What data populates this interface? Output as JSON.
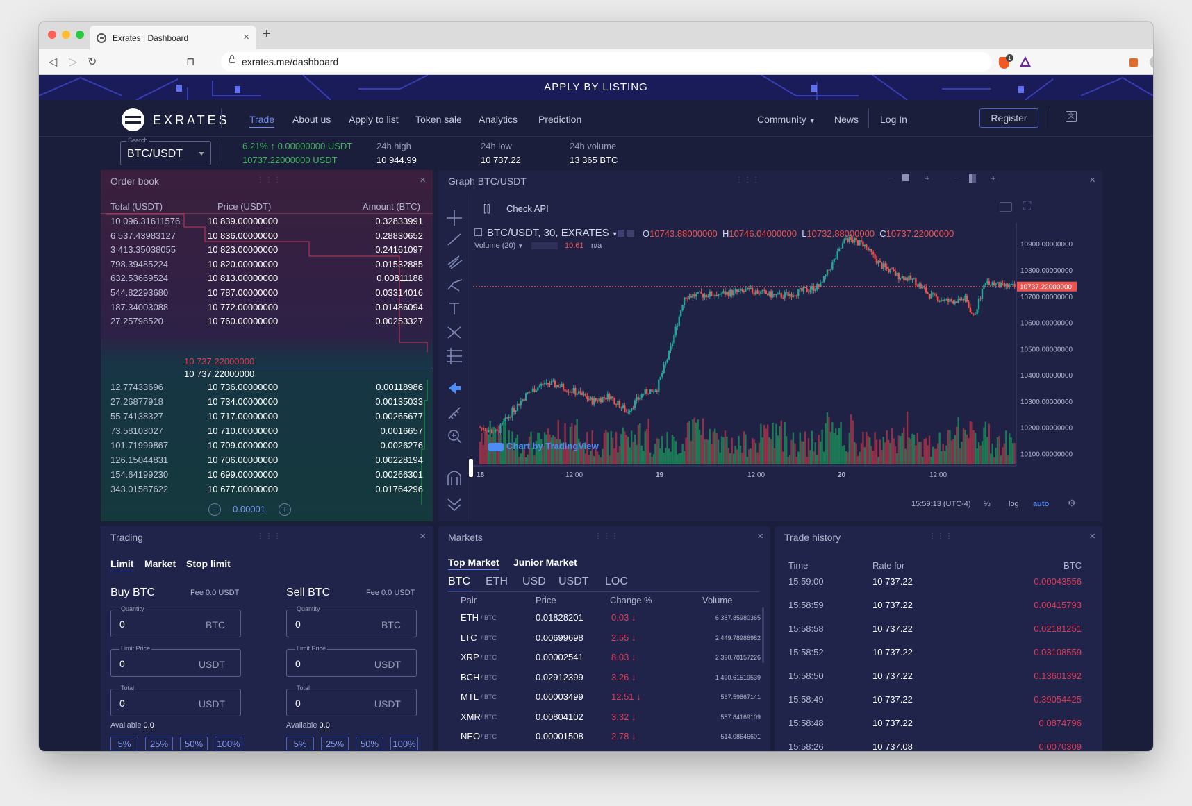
{
  "browser": {
    "tab_title": "Exrates | Dashboard",
    "url": "exrates.me/dashboard"
  },
  "site": {
    "banner": "APPLY BY LISTING",
    "logo": "EXRATES",
    "nav": [
      "Trade",
      "About us",
      "Apply to list",
      "Token sale",
      "Analytics",
      "Prediction"
    ],
    "community": "Community",
    "news": "News",
    "login": "Log In",
    "register": "Register"
  },
  "ticker": {
    "search_label": "Search",
    "pair": "BTC/USDT",
    "change": "6.21% ↑ 0.00000000 USDT",
    "last": "10737.22000000 USDT",
    "high_label": "24h high",
    "high": "10 944.99",
    "low_label": "24h low",
    "low": "10 737.22",
    "vol_label": "24h volume",
    "vol": "13 365 BTC"
  },
  "orderbook": {
    "title": "Order book",
    "headers": [
      "Total (USDT)",
      "Price (USDT)",
      "Amount (BTC)"
    ],
    "asks": [
      [
        "10 096.31611576",
        "10 839.00000000",
        "0.32833991"
      ],
      [
        "6 537.43983127",
        "10 836.00000000",
        "0.28830652"
      ],
      [
        "3 413.35038055",
        "10 823.00000000",
        "0.24161097"
      ],
      [
        "798.39485224",
        "10 820.00000000",
        "0.01532885"
      ],
      [
        "632.53669524",
        "10 813.00000000",
        "0.00811188"
      ],
      [
        "544.82293680",
        "10 787.00000000",
        "0.03314016"
      ],
      [
        "187.34003088",
        "10 772.00000000",
        "0.01486094"
      ],
      [
        "27.25798520",
        "10 760.00000000",
        "0.00253327"
      ]
    ],
    "last_price_red": "10 737.22000000",
    "last_price": "10 737.22000000",
    "bids": [
      [
        "12.77433696",
        "10 736.00000000",
        "0.00118986"
      ],
      [
        "27.26877918",
        "10 734.00000000",
        "0.00135033"
      ],
      [
        "55.74138327",
        "10 717.00000000",
        "0.00265677"
      ],
      [
        "73.58103027",
        "10 710.00000000",
        "0.0016657"
      ],
      [
        "101.71999867",
        "10 709.00000000",
        "0.0026276"
      ],
      [
        "126.15044831",
        "10 706.00000000",
        "0.00228194"
      ],
      [
        "154.64199230",
        "10 699.00000000",
        "0.00266301"
      ],
      [
        "343.01587622",
        "10 677.00000000",
        "0.01764296"
      ]
    ],
    "step": "0.00001"
  },
  "graph": {
    "title": "Graph BTC/USDT",
    "check_api": "Check API",
    "symbol": "BTC/USDT, 30, EXRATES",
    "o_label": "O",
    "o": "10743.88000000",
    "h_label": "H",
    "h": "10746.04000000",
    "l_label": "L",
    "l": "10732.88000000",
    "c_label": "C",
    "c": "10737.22000000",
    "volume_label": "Volume (20)",
    "volume_val": "10.61",
    "volume_na": "n/a",
    "watermark": "Chart by TradingView",
    "time": "15:59:13 (UTC-4)",
    "pct": "%",
    "log": "log",
    "auto": "auto",
    "price_tag": "10737.22000000",
    "colors": {
      "up": "#26a69a",
      "down": "#ef5350",
      "vol_up": "#1d8a5a",
      "vol_down": "#a8324a"
    }
  },
  "chart_data": {
    "type": "candlestick",
    "x_ticks": [
      "18",
      "12:00",
      "19",
      "12:00",
      "20",
      "12:00"
    ],
    "y_ticks": [
      "10900.00000000",
      "10800.00000000",
      "10700.00000000",
      "10600.00000000",
      "10500.00000000",
      "10400.00000000",
      "10300.00000000",
      "10200.00000000",
      "10100.00000000"
    ],
    "ylim": [
      10080,
      10980
    ],
    "last_price": 10737.22
  },
  "trading": {
    "title": "Trading",
    "tabs": [
      "Limit",
      "Market",
      "Stop limit"
    ],
    "buy": {
      "title": "Buy BTC",
      "fee": "Fee 0.0 USDT",
      "qty_label": "Quantity",
      "qty": "0",
      "qty_unit": "BTC",
      "limit_label": "Limit Price",
      "limit": "0",
      "limit_unit": "USDT",
      "total_label": "Total",
      "total": "0",
      "total_unit": "USDT",
      "avail_label": "Available",
      "avail": "0.0"
    },
    "sell": {
      "title": "Sell BTC",
      "fee": "Fee 0.0 USDT",
      "qty_label": "Quantity",
      "qty": "0",
      "qty_unit": "BTC",
      "limit_label": "Limit Price",
      "limit": "0",
      "limit_unit": "USDT",
      "total_label": "Total",
      "total": "0",
      "total_unit": "USDT",
      "avail_label": "Available",
      "avail": "0.0"
    },
    "pcts": [
      "5%",
      "25%",
      "50%",
      "100%"
    ]
  },
  "markets": {
    "title": "Markets",
    "tabs": [
      "Top Market",
      "Junior Market"
    ],
    "currencies": [
      "BTC",
      "ETH",
      "USD",
      "USDT",
      "LOC"
    ],
    "headers": [
      "Pair",
      "Price",
      "Change %",
      "Volume"
    ],
    "rows": [
      {
        "pair": "ETH",
        "quote": "/ BTC",
        "price": "0.01828201",
        "change": "0.03 ↓",
        "volume": "6 387.85980365"
      },
      {
        "pair": "LTC",
        "quote": "/ BTC",
        "price": "0.00699698",
        "change": "2.55 ↓",
        "volume": "2 449.78986982"
      },
      {
        "pair": "XRP",
        "quote": "/ BTC",
        "price": "0.00002541",
        "change": "8.03 ↓",
        "volume": "2 390.78157226"
      },
      {
        "pair": "BCH",
        "quote": "/ BTC",
        "price": "0.02912399",
        "change": "3.26 ↓",
        "volume": "1 490.61519539"
      },
      {
        "pair": "MTL",
        "quote": "/ BTC",
        "price": "0.00003499",
        "change": "12.51 ↓",
        "volume": "567.59867141"
      },
      {
        "pair": "XMR",
        "quote": "/ BTC",
        "price": "0.00804102",
        "change": "3.32 ↓",
        "volume": "557.84169109"
      },
      {
        "pair": "NEO",
        "quote": "/ BTC",
        "price": "0.00001508",
        "change": "2.78 ↓",
        "volume": "514.08646601"
      }
    ]
  },
  "history": {
    "title": "Trade history",
    "headers": [
      "Time",
      "Rate for",
      "BTC"
    ],
    "rows": [
      [
        "15:59:00",
        "10 737.22",
        "0.00043556"
      ],
      [
        "15:58:59",
        "10 737.22",
        "0.00415793"
      ],
      [
        "15:58:58",
        "10 737.22",
        "0.02181251"
      ],
      [
        "15:58:52",
        "10 737.22",
        "0.03108559"
      ],
      [
        "15:58:50",
        "10 737.22",
        "0.13601392"
      ],
      [
        "15:58:49",
        "10 737.22",
        "0.39054425"
      ],
      [
        "15:58:48",
        "10 737.22",
        "0.0874796"
      ],
      [
        "15:58:26",
        "10 737.08",
        "0.0070309"
      ]
    ]
  }
}
